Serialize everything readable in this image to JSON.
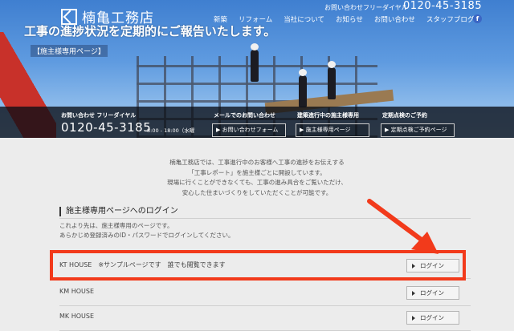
{
  "header": {
    "logo_text": "楠亀工務店",
    "free_dial_label": "お問い合わせフリーダイヤル",
    "phone": "0120-45-3185",
    "nav": [
      "新築",
      "リフォーム",
      "当社について",
      "お知らせ",
      "お問い合わせ",
      "スタッフブログ"
    ],
    "facebook_glyph": "f"
  },
  "hero": {
    "title": "工事の進捗状況を定期的にご報告いたします。",
    "subtitle": "【施主様専用ページ】"
  },
  "contact_bar": {
    "phone_label": "お問い合わせ フリーダイヤル",
    "phone": "0120-45-3185",
    "hours": "8:00 - 18:00（水曜",
    "mail_label": "メールでのお問い合わせ",
    "mail_button": "お問い合わせフォーム",
    "owner_label": "建築進行中の施主様専用",
    "owner_button": "施主様専用ページ",
    "inspect_label": "定期点検のご予約",
    "inspect_button": "定期点検ご予約ページ"
  },
  "intro": [
    "楠亀工務店では、工事進行中のお客様へ工事の進捗をお伝えする",
    "「工事レポート」を施主様ごとに開設しています。",
    "現場に行くことができなくても、工事の進み具合をご覧いただけ、",
    "安心した住まいづくりをしていただくことが可能です。"
  ],
  "login": {
    "title": "施主様専用ページへのログイン",
    "desc_1": "これより先は、施主様専用のページです。",
    "desc_2": "あらかじめ登録済みのID・パスワードでログインしてください。",
    "rows": [
      {
        "label": "KT HOUSE　※サンプルページです　誰でも閲覧できます",
        "button": "ログイン"
      },
      {
        "label": "KM HOUSE",
        "button": "ログイン"
      },
      {
        "label": "MK HOUSE",
        "button": "ログイン"
      }
    ]
  },
  "colors": {
    "highlight": "#f23a1b",
    "facebook": "#3b66c4"
  }
}
